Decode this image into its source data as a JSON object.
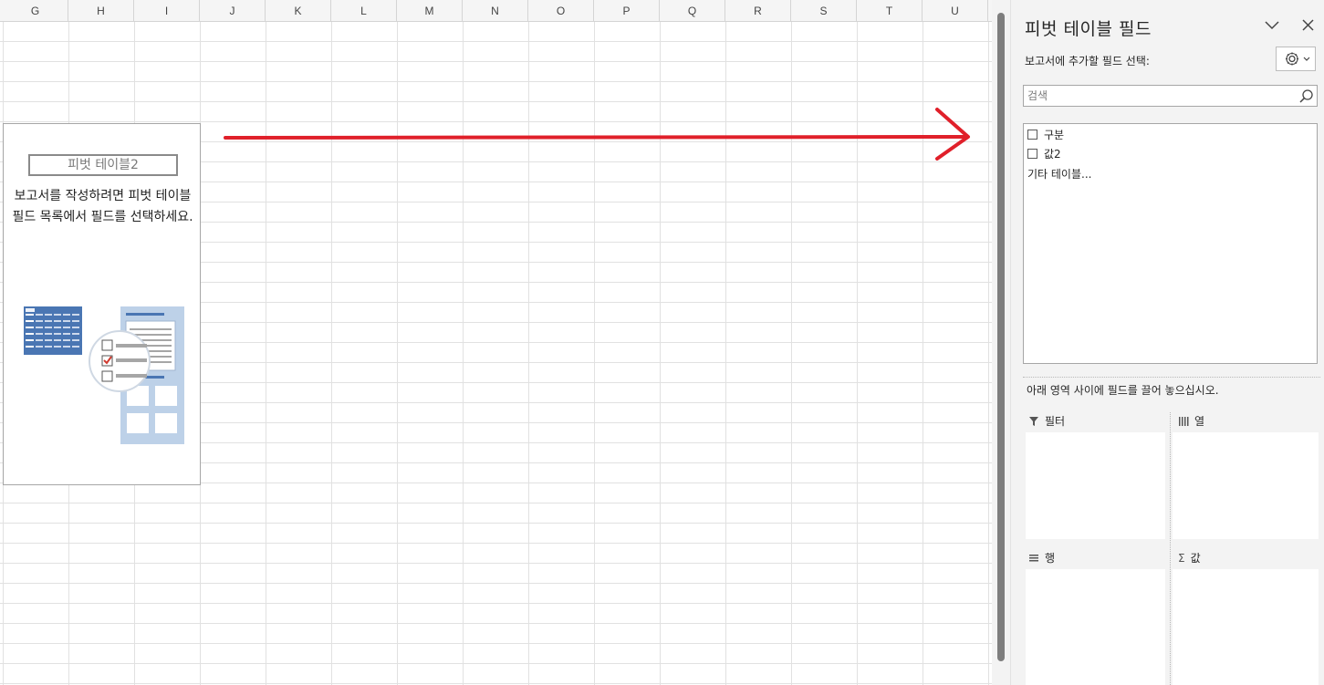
{
  "sheet": {
    "columns": [
      "G",
      "H",
      "I",
      "J",
      "K",
      "L",
      "M",
      "N",
      "O",
      "P",
      "Q",
      "R",
      "S",
      "T",
      "U"
    ],
    "pivot_placeholder": {
      "name": "피벗 테이블2",
      "message": "보고서를 작성하려면 피벗 테이블 필드 목록에서 필드를 선택하세요."
    }
  },
  "pane": {
    "title": "피벗 테이블 필드",
    "subtitle": "보고서에 추가할 필드 선택:",
    "search_placeholder": "검색",
    "fields": [
      {
        "label": "구분",
        "checked": false
      },
      {
        "label": "값2",
        "checked": false
      }
    ],
    "more_tables": "기타 테이블...",
    "areas_hint": "아래 영역 사이에 필드를 끌어 놓으십시오.",
    "areas": {
      "filters": "필터",
      "columns": "열",
      "rows": "행",
      "values": "값"
    }
  },
  "colors": {
    "arrow": "#e0202a",
    "pane_bg": "#f3f3f3",
    "illustration_blue": "#4472c4"
  },
  "icons": [
    "chevron-down-icon",
    "close-icon",
    "gear-icon",
    "search-icon",
    "filter-icon",
    "columns-icon",
    "rows-icon",
    "sigma-icon"
  ]
}
